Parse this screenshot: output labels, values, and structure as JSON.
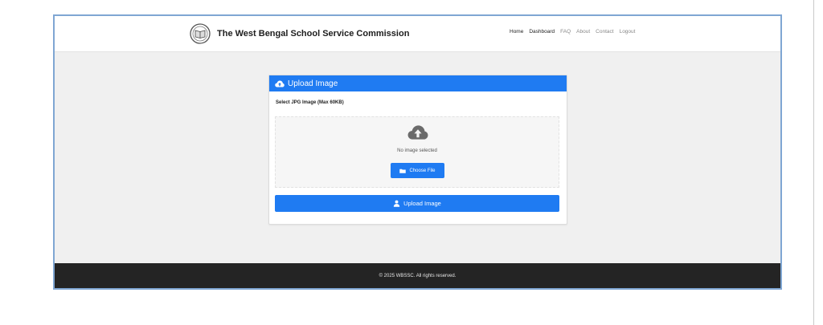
{
  "header": {
    "title": "The West Bengal School Service Commission",
    "nav": [
      {
        "label": "Home"
      },
      {
        "label": "Dashboard"
      },
      {
        "label": "FAQ"
      },
      {
        "label": "About"
      },
      {
        "label": "Contact"
      },
      {
        "label": "Logout"
      }
    ]
  },
  "upload_card": {
    "title": "Upload Image",
    "title_icon": "cloud-upload-icon",
    "select_label": "Select JPG Image (Max 60KB)",
    "dropzone": {
      "icon": "cloud-upload-icon",
      "status": "No image selected",
      "choose_label": "Choose File",
      "choose_icon": "folder-icon"
    },
    "upload_label": "Upload Image",
    "upload_icon": "user-upload-icon"
  },
  "footer": {
    "copyright": "© 2025 WBSSC. All rights reserved."
  },
  "colors": {
    "primary": "#1f7bf2",
    "footer_bg": "#242424",
    "page_bg": "#f0f0f0",
    "frame_border": "#7fa6d3"
  }
}
